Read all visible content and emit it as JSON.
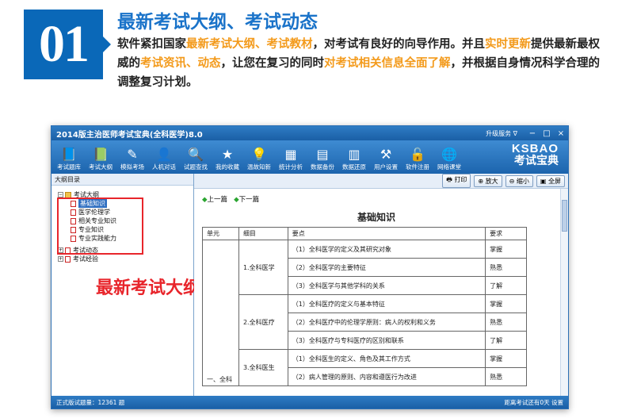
{
  "header": {
    "number": "01",
    "title": "最新考试大纲、考试动态",
    "desc_parts": [
      {
        "text": "软件紧扣国家",
        "hl": false
      },
      {
        "text": "最新考试大纲、考试教材",
        "hl": true
      },
      {
        "text": "，对考试有良好的向导作用。并且",
        "hl": false
      },
      {
        "text": "实时更新",
        "hl": true
      },
      {
        "text": "提供最新最权威的",
        "hl": false
      },
      {
        "text": "考试资讯、动态",
        "hl": true
      },
      {
        "text": "，让您在复习的同时",
        "hl": false
      },
      {
        "text": "对考试相关信息全面了解",
        "hl": true
      },
      {
        "text": "，并根据自身情况科学合理的调整复习计划。",
        "hl": false
      }
    ]
  },
  "window": {
    "title": "2014版主治医师考试宝典(全科医学)8.0",
    "upgrade": "升级服务 ∇",
    "controls": [
      "−",
      "□",
      "×"
    ],
    "toolbar": [
      {
        "icon": "book-icon",
        "glyph": "📘",
        "label": "考试题库"
      },
      {
        "icon": "outline-icon",
        "glyph": "📗",
        "label": "考试大纲"
      },
      {
        "icon": "pen-icon",
        "glyph": "✎",
        "label": "模拟考场"
      },
      {
        "icon": "person-icon",
        "glyph": "👤",
        "label": "人机对话"
      },
      {
        "icon": "magnifier-icon",
        "glyph": "🔍",
        "label": "试题查找"
      },
      {
        "icon": "star-icon",
        "glyph": "★",
        "label": "我的收藏"
      },
      {
        "icon": "bulb-icon",
        "glyph": "💡",
        "label": "温故知新"
      },
      {
        "icon": "chart-icon",
        "glyph": "▦",
        "label": "统计分析"
      },
      {
        "icon": "backup-icon",
        "glyph": "▤",
        "label": "数据备份"
      },
      {
        "icon": "restore-icon",
        "glyph": "▥",
        "label": "数据还原"
      },
      {
        "icon": "settings-icon",
        "glyph": "⚒",
        "label": "用户设置"
      },
      {
        "icon": "lock-icon",
        "glyph": "🔓",
        "label": "软件注册"
      },
      {
        "icon": "globe-icon",
        "glyph": "🌐",
        "label": "网络课堂"
      }
    ],
    "brand_en": "KSBAO",
    "brand_cn": "考试宝典",
    "tree_head": "大纲目录",
    "tree": [
      {
        "label": "考试大纲",
        "level": 0,
        "toggle": "−",
        "icon": "folder"
      },
      {
        "label": "基础知识",
        "level": 1,
        "icon": "doc",
        "selected": true
      },
      {
        "label": "医学伦理学",
        "level": 1,
        "icon": "doc"
      },
      {
        "label": "相关专业知识",
        "level": 1,
        "icon": "doc"
      },
      {
        "label": "专业知识",
        "level": 1,
        "icon": "doc"
      },
      {
        "label": "专业实践能力",
        "level": 1,
        "icon": "doc"
      },
      {
        "label": "考试动态",
        "level": 0,
        "toggle": "+",
        "icon": "doc"
      },
      {
        "label": "考试经验",
        "level": 0,
        "toggle": "+",
        "icon": "doc"
      }
    ],
    "annotation": "最新考试大纲",
    "doc_buttons": {
      "print": "打印",
      "zoom_in": "放大",
      "zoom_out": "缩小",
      "fullscreen": "全屏"
    },
    "prev": "上一篇",
    "next": "下一篇",
    "doc_title": "基础知识",
    "table": {
      "headers": [
        "单元",
        "细目",
        "要点",
        "要求"
      ],
      "unit": "一、全科",
      "groups": [
        {
          "subject": "1.全科医学",
          "points": [
            {
              "text": "（1）全科医学的定义及其研究对象",
              "req": "掌握"
            },
            {
              "text": "（2）全科医学的主要特征",
              "req": "熟悉"
            },
            {
              "text": "（3）全科医学与其他学科的关系",
              "req": "了解"
            }
          ]
        },
        {
          "subject": "2.全科医疗",
          "points": [
            {
              "text": "（1）全科医疗的定义与基本特征",
              "req": "掌握"
            },
            {
              "text": "（2）全科医疗中的伦理学原则：病人的权利和义务",
              "req": "熟悉"
            },
            {
              "text": "（3）全科医疗与专科医疗的区别和联系",
              "req": "了解"
            }
          ]
        },
        {
          "subject": "3.全科医生",
          "points": [
            {
              "text": "（1）全科医生的定义、角色及其工作方式",
              "req": "掌握"
            },
            {
              "text": "（2）病人管理的原则、内容和遵医行为改进",
              "req": "熟悉"
            }
          ]
        }
      ]
    },
    "status_left": "正式版试题量：12361 题",
    "status_right": "距离考试还有0天  设置"
  }
}
